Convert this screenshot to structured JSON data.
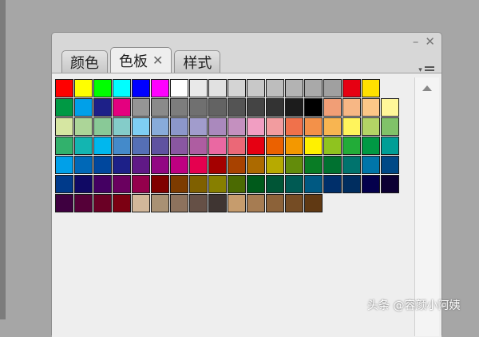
{
  "panel": {
    "tabs": [
      {
        "label": "颜色",
        "active": false
      },
      {
        "label": "色板",
        "active": true,
        "close_glyph": "✕"
      },
      {
        "label": "样式",
        "active": false
      }
    ],
    "controls": {
      "minimize": "–",
      "close": "✕"
    },
    "menu_glyph": "▾"
  },
  "swatches": [
    [
      "#ff0000",
      "#ffff00",
      "#00ff00",
      "#00ffff",
      "#0000ff",
      "#ff00ff",
      "#ffffff",
      "#e9e9e9",
      "#e1e1e1",
      "#d4d4d4",
      "#c8c8c8",
      "#bdbdbd",
      "#b3b3b3",
      "#a9a9a9",
      "#a0a0a0",
      "#e60012",
      "#ffe100"
    ],
    [
      "#009944",
      "#00a0e9",
      "#1d2088",
      "#e4007f",
      "#959595",
      "#8a8a8a",
      "#7d7d7d",
      "#707070",
      "#636363",
      "#545454",
      "#444444",
      "#333333",
      "#1c1c1c",
      "#000000",
      "#f19e76",
      "#f7b785",
      "#fcc787",
      "#fff799"
    ],
    [
      "#d6e6a2",
      "#acd598",
      "#89c997",
      "#84ccc9",
      "#7ecef4",
      "#88abda",
      "#8c97cb",
      "#a19ccc",
      "#aa89bd",
      "#c490bf",
      "#f19ec2",
      "#f29c9f",
      "#f0714b",
      "#f39149",
      "#f8b551",
      "#fff45c",
      "#b3d465",
      "#80c269"
    ],
    [
      "#32b16c",
      "#13b5b1",
      "#00b7ee",
      "#448aca",
      "#556fb5",
      "#5f52a0",
      "#8957a1",
      "#ae5da1",
      "#ea68a2",
      "#eb6877",
      "#e60012",
      "#eb6100",
      "#f39800",
      "#fff100",
      "#8fc31f",
      "#22ac38",
      "#009944",
      "#009e96"
    ],
    [
      "#00a0e9",
      "#0068b7",
      "#00479d",
      "#1d2088",
      "#601986",
      "#920783",
      "#be0081",
      "#e5004f",
      "#a40000",
      "#a84200",
      "#ac6a00",
      "#b7aa00",
      "#638c0b",
      "#097c25",
      "#007130",
      "#00736d",
      "#0075a9",
      "#004986"
    ],
    [
      "#003a8a",
      "#100964",
      "#440062",
      "#6a005f",
      "#94004c",
      "#800000",
      "#7d3b00",
      "#7f6000",
      "#877f00",
      "#4b6a02",
      "#005a1b",
      "#005536",
      "#005a53",
      "#005982",
      "#002f6a",
      "#002d5f",
      "#04004c",
      "#0d0033"
    ],
    [
      "#3e0040",
      "#550038",
      "#6a0025",
      "#7c0012",
      "#d2b79a",
      "#a99174",
      "#8d725d",
      "#655046",
      "#3f3532",
      "#c69c6d",
      "#a67c52",
      "#8c6239",
      "#754c24",
      "#603913"
    ]
  ],
  "watermark": "头条 @容颜小阿姨"
}
